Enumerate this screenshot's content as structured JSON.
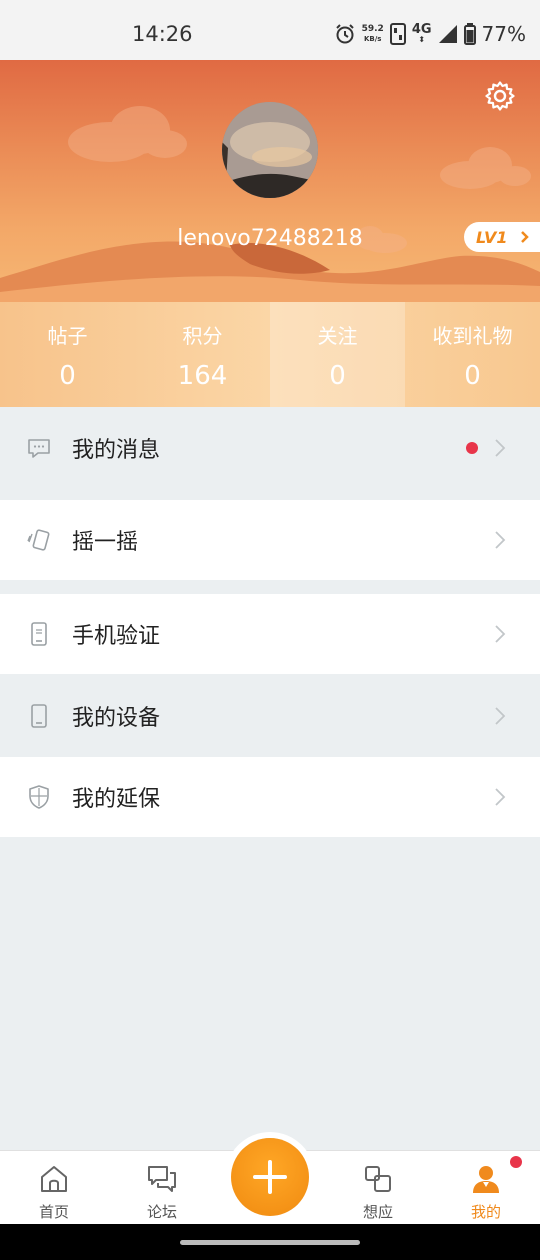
{
  "status_bar": {
    "time": "14:26",
    "net_speed_value": "59.2",
    "net_speed_unit": "KB/s",
    "network": "4G",
    "battery": "77%"
  },
  "profile": {
    "username": "lenovo72488218",
    "level": "LV1"
  },
  "stats": [
    {
      "label": "帖子",
      "value": "0"
    },
    {
      "label": "积分",
      "value": "164"
    },
    {
      "label": "关注",
      "value": "0"
    },
    {
      "label": "收到礼物",
      "value": "0"
    }
  ],
  "menu": {
    "messages": "我的消息",
    "shake": "摇一摇",
    "phone_verify": "手机验证",
    "devices": "我的设备",
    "warranty": "我的延保"
  },
  "nav": {
    "home": "首页",
    "forum": "论坛",
    "ideas": "想应",
    "mine": "我的"
  },
  "colors": {
    "accent": "#f08a1d",
    "badge_red": "#e8354a"
  }
}
